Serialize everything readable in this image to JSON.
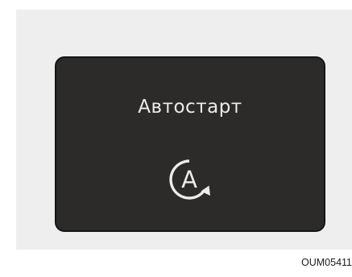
{
  "display": {
    "title": "Автостарт",
    "icon": {
      "name": "auto-start-icon",
      "letter": "A"
    }
  },
  "figure_code": "OUM05411",
  "colors": {
    "backdrop": "#eeeeee",
    "display_background": "#2c2b2a",
    "display_border": "#151515",
    "display_text": "#ececec",
    "page_background": "#ffffff"
  }
}
